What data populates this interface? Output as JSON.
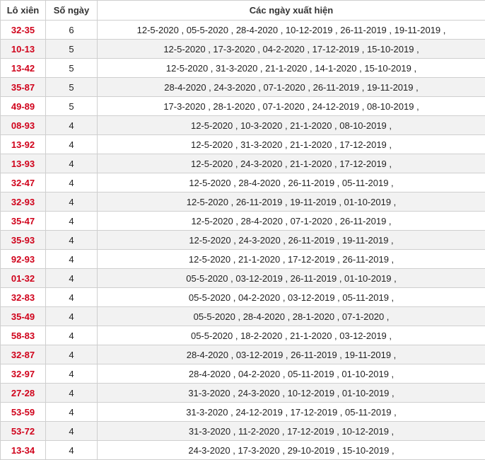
{
  "headers": {
    "pair": "Lô xiên",
    "count": "Số ngày",
    "dates": "Các ngày xuất hiện"
  },
  "rows": [
    {
      "pair": "32-35",
      "count": "6",
      "dates": "12-5-2020 , 05-5-2020 , 28-4-2020 , 10-12-2019 , 26-11-2019 , 19-11-2019 ,"
    },
    {
      "pair": "10-13",
      "count": "5",
      "dates": "12-5-2020 , 17-3-2020 , 04-2-2020 , 17-12-2019 , 15-10-2019 ,"
    },
    {
      "pair": "13-42",
      "count": "5",
      "dates": "12-5-2020 , 31-3-2020 , 21-1-2020 , 14-1-2020 , 15-10-2019 ,"
    },
    {
      "pair": "35-87",
      "count": "5",
      "dates": "28-4-2020 , 24-3-2020 , 07-1-2020 , 26-11-2019 , 19-11-2019 ,"
    },
    {
      "pair": "49-89",
      "count": "5",
      "dates": "17-3-2020 , 28-1-2020 , 07-1-2020 , 24-12-2019 , 08-10-2019 ,"
    },
    {
      "pair": "08-93",
      "count": "4",
      "dates": "12-5-2020 , 10-3-2020 , 21-1-2020 , 08-10-2019 ,"
    },
    {
      "pair": "13-92",
      "count": "4",
      "dates": "12-5-2020 , 31-3-2020 , 21-1-2020 , 17-12-2019 ,"
    },
    {
      "pair": "13-93",
      "count": "4",
      "dates": "12-5-2020 , 24-3-2020 , 21-1-2020 , 17-12-2019 ,"
    },
    {
      "pair": "32-47",
      "count": "4",
      "dates": "12-5-2020 , 28-4-2020 , 26-11-2019 , 05-11-2019 ,"
    },
    {
      "pair": "32-93",
      "count": "4",
      "dates": "12-5-2020 , 26-11-2019 , 19-11-2019 , 01-10-2019 ,"
    },
    {
      "pair": "35-47",
      "count": "4",
      "dates": "12-5-2020 , 28-4-2020 , 07-1-2020 , 26-11-2019 ,"
    },
    {
      "pair": "35-93",
      "count": "4",
      "dates": "12-5-2020 , 24-3-2020 , 26-11-2019 , 19-11-2019 ,"
    },
    {
      "pair": "92-93",
      "count": "4",
      "dates": "12-5-2020 , 21-1-2020 , 17-12-2019 , 26-11-2019 ,"
    },
    {
      "pair": "01-32",
      "count": "4",
      "dates": "05-5-2020 , 03-12-2019 , 26-11-2019 , 01-10-2019 ,"
    },
    {
      "pair": "32-83",
      "count": "4",
      "dates": "05-5-2020 , 04-2-2020 , 03-12-2019 , 05-11-2019 ,"
    },
    {
      "pair": "35-49",
      "count": "4",
      "dates": "05-5-2020 , 28-4-2020 , 28-1-2020 , 07-1-2020 ,"
    },
    {
      "pair": "58-83",
      "count": "4",
      "dates": "05-5-2020 , 18-2-2020 , 21-1-2020 , 03-12-2019 ,"
    },
    {
      "pair": "32-87",
      "count": "4",
      "dates": "28-4-2020 , 03-12-2019 , 26-11-2019 , 19-11-2019 ,"
    },
    {
      "pair": "32-97",
      "count": "4",
      "dates": "28-4-2020 , 04-2-2020 , 05-11-2019 , 01-10-2019 ,"
    },
    {
      "pair": "27-28",
      "count": "4",
      "dates": "31-3-2020 , 24-3-2020 , 10-12-2019 , 01-10-2019 ,"
    },
    {
      "pair": "53-59",
      "count": "4",
      "dates": "31-3-2020 , 24-12-2019 , 17-12-2019 , 05-11-2019 ,"
    },
    {
      "pair": "53-72",
      "count": "4",
      "dates": "31-3-2020 , 11-2-2020 , 17-12-2019 , 10-12-2019 ,"
    },
    {
      "pair": "13-34",
      "count": "4",
      "dates": "24-3-2020 , 17-3-2020 , 29-10-2019 , 15-10-2019 ,"
    }
  ],
  "colors": {
    "pair_text": "#d0021b",
    "border": "#cfcfcf",
    "stripe": "#f2f2f2"
  }
}
